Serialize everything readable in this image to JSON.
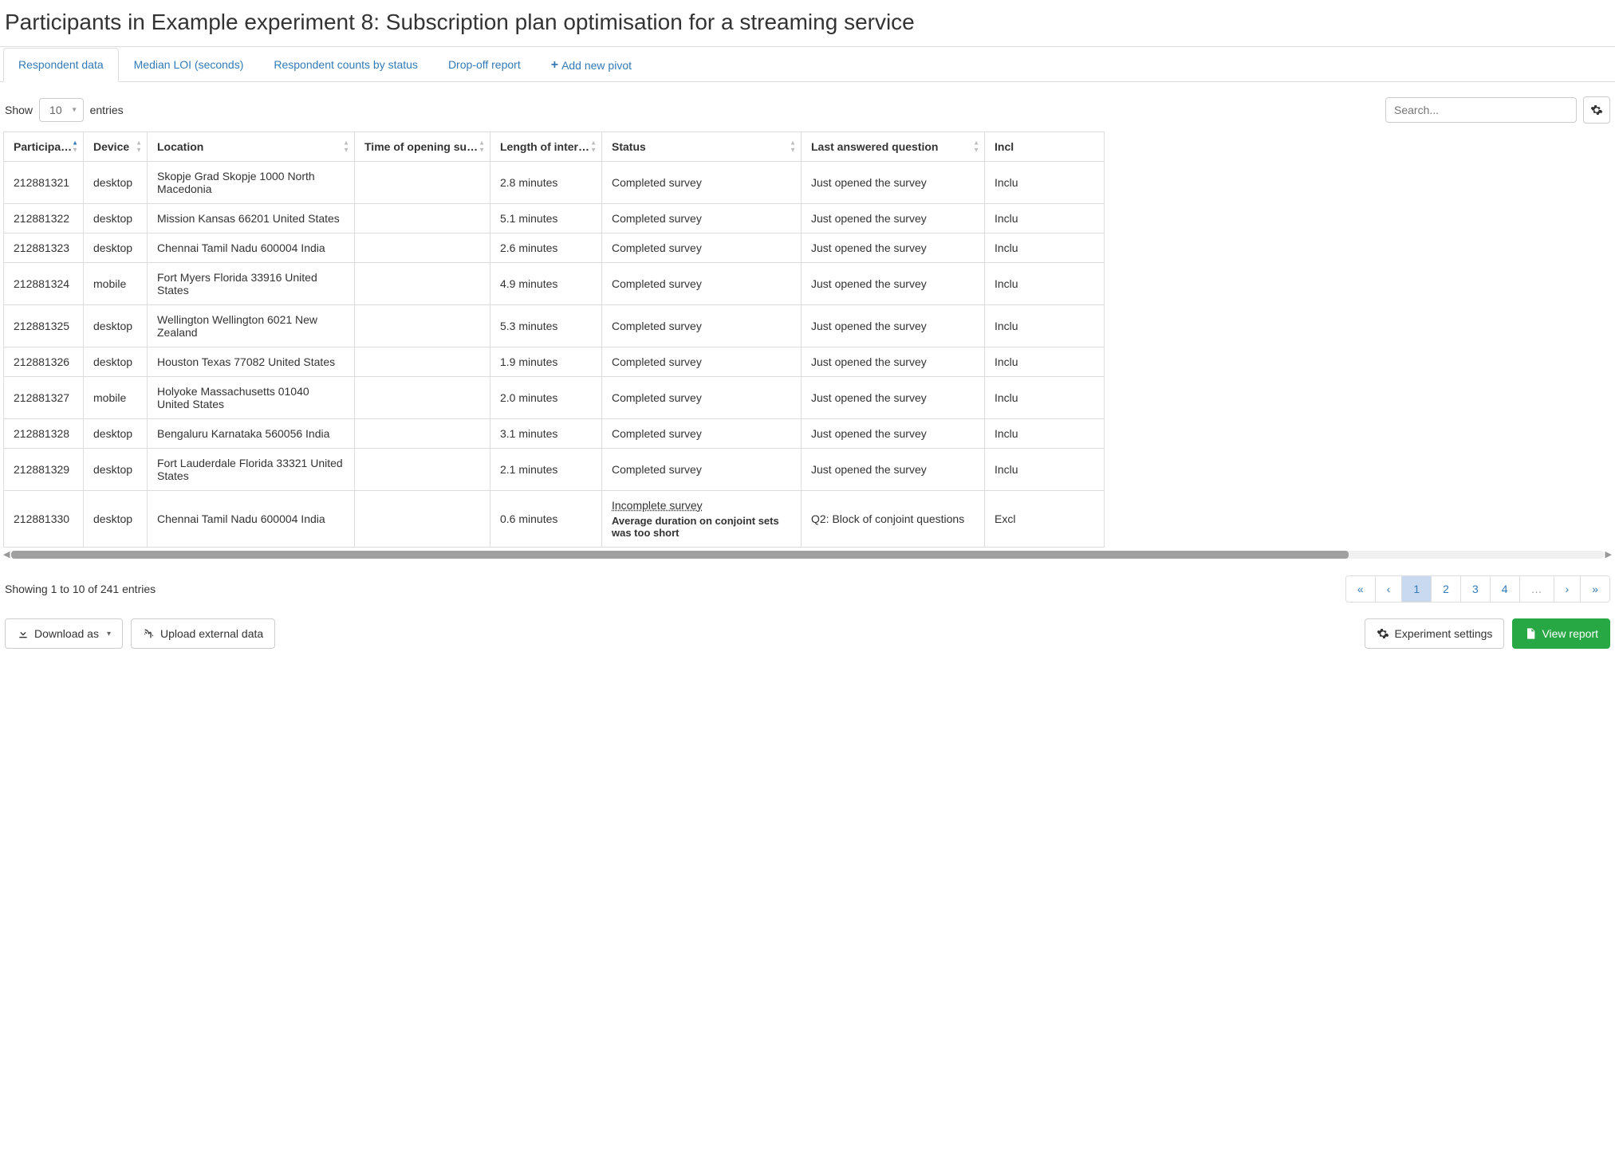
{
  "header": {
    "title": "Participants in Example experiment 8: Subscription plan optimisation for a streaming service"
  },
  "tabs": [
    {
      "label": "Respondent data",
      "active": true
    },
    {
      "label": "Median LOI (seconds)",
      "active": false
    },
    {
      "label": "Respondent counts by status",
      "active": false
    },
    {
      "label": "Drop-off report",
      "active": false
    }
  ],
  "add_pivot_label": "Add new pivot",
  "controls": {
    "show_label": "Show",
    "entries_label": "entries",
    "page_size": "10",
    "search_placeholder": "Search..."
  },
  "table": {
    "columns": [
      "Participa…",
      "Device",
      "Location",
      "Time of opening survey",
      "Length of interview",
      "Status",
      "Last answered question",
      "Incl"
    ],
    "rows": [
      {
        "id": "212881321",
        "device": "desktop",
        "location": "Skopje Grad Skopje 1000 North Macedonia",
        "time": "",
        "length": "2.8 minutes",
        "status": "Completed survey",
        "status_sub": "",
        "question": "Just opened the survey",
        "incl": "Inclu"
      },
      {
        "id": "212881322",
        "device": "desktop",
        "location": "Mission Kansas 66201 United States",
        "time": "",
        "length": "5.1 minutes",
        "status": "Completed survey",
        "status_sub": "",
        "question": "Just opened the survey",
        "incl": "Inclu"
      },
      {
        "id": "212881323",
        "device": "desktop",
        "location": "Chennai Tamil Nadu 600004 India",
        "time": "",
        "length": "2.6 minutes",
        "status": "Completed survey",
        "status_sub": "",
        "question": "Just opened the survey",
        "incl": "Inclu"
      },
      {
        "id": "212881324",
        "device": "mobile",
        "location": "Fort Myers Florida 33916 United States",
        "time": "",
        "length": "4.9 minutes",
        "status": "Completed survey",
        "status_sub": "",
        "question": "Just opened the survey",
        "incl": "Inclu"
      },
      {
        "id": "212881325",
        "device": "desktop",
        "location": "Wellington Wellington 6021 New Zealand",
        "time": "",
        "length": "5.3 minutes",
        "status": "Completed survey",
        "status_sub": "",
        "question": "Just opened the survey",
        "incl": "Inclu"
      },
      {
        "id": "212881326",
        "device": "desktop",
        "location": "Houston Texas 77082 United States",
        "time": "",
        "length": "1.9 minutes",
        "status": "Completed survey",
        "status_sub": "",
        "question": "Just opened the survey",
        "incl": "Inclu"
      },
      {
        "id": "212881327",
        "device": "mobile",
        "location": "Holyoke Massachusetts 01040 United States",
        "time": "",
        "length": "2.0 minutes",
        "status": "Completed survey",
        "status_sub": "",
        "question": "Just opened the survey",
        "incl": "Inclu"
      },
      {
        "id": "212881328",
        "device": "desktop",
        "location": "Bengaluru Karnataka 560056 India",
        "time": "",
        "length": "3.1 minutes",
        "status": "Completed survey",
        "status_sub": "",
        "question": "Just opened the survey",
        "incl": "Inclu"
      },
      {
        "id": "212881329",
        "device": "desktop",
        "location": "Fort Lauderdale Florida 33321 United States",
        "time": "",
        "length": "2.1 minutes",
        "status": "Completed survey",
        "status_sub": "",
        "question": "Just opened the survey",
        "incl": "Inclu"
      },
      {
        "id": "212881330",
        "device": "desktop",
        "location": "Chennai Tamil Nadu 600004 India",
        "time": "",
        "length": "0.6 minutes",
        "status": "Incomplete survey",
        "status_sub": "Average duration on conjoint sets was too short",
        "question": "Q2: Block of conjoint questions",
        "incl": "Excl"
      }
    ]
  },
  "footer": {
    "showing_text": "Showing 1 to 10 of 241 entries",
    "pages": [
      "«",
      "‹",
      "1",
      "2",
      "3",
      "4",
      "…",
      "›",
      "»"
    ],
    "active_page": "1"
  },
  "actions": {
    "download": "Download as",
    "upload": "Upload external data",
    "experiment_settings": "Experiment settings",
    "view_report": "View report"
  }
}
